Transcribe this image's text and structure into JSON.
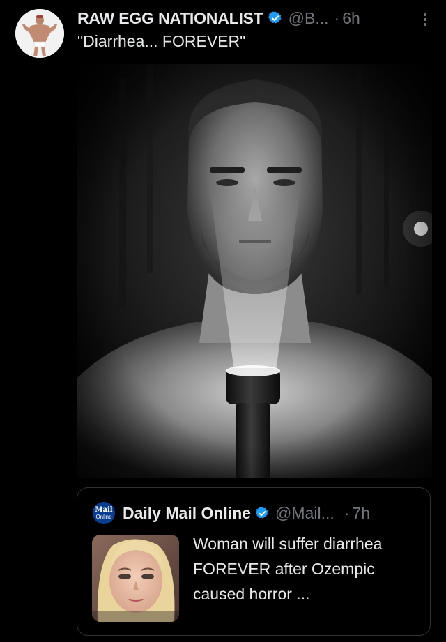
{
  "post": {
    "author_name": "RAW EGG NATIONALIST",
    "handle": "@B...",
    "dot": "·",
    "time": "6h",
    "text": "\"Diarrhea... FOREVER\"",
    "avatar_icon": "bodybuilder-avatar",
    "media_icon": "man-with-flashlight-image"
  },
  "quote": {
    "logo_line1": "Mail",
    "logo_line2": "Online",
    "author_name": "Daily Mail Online",
    "handle": "@Mail...",
    "dot": "·",
    "time": "7h",
    "text": "Woman will suffer diarrhea FOREVER after Ozempic caused horror ...",
    "thumb_icon": "woman-portrait-thumbnail"
  },
  "colors": {
    "background": "#000000",
    "text_primary": "#e7e9ea",
    "text_secondary": "#71767b",
    "verified_blue": "#1d9bf0",
    "card_border": "#2f3336",
    "mail_logo_blue": "#0a3d8f"
  }
}
